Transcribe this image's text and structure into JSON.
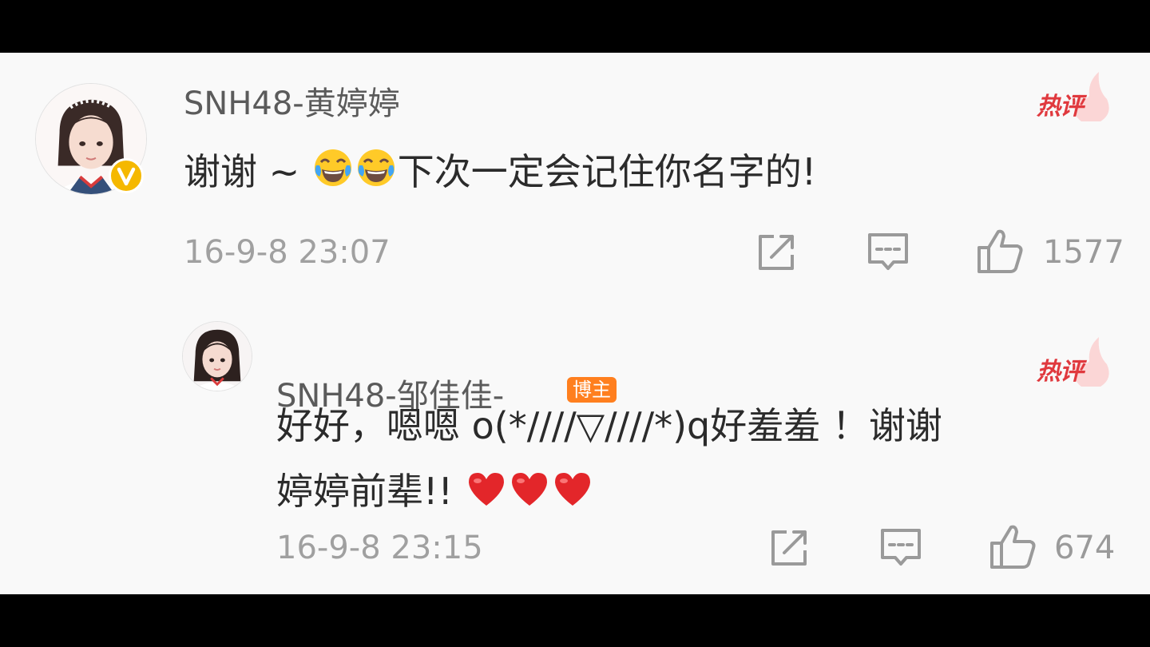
{
  "comments": [
    {
      "username": "SNH48-黄婷婷",
      "hot_label": "热评",
      "text_before": "谢谢 ~ ",
      "text_after": "下次一定会记住你名字的!",
      "emoji": [
        "laughing-tears-emoji",
        "laughing-tears-emoji"
      ],
      "timestamp": "16-9-8 23:07",
      "like_count": "1577",
      "verified": true
    },
    {
      "username": "SNH48-邹佳佳-",
      "author_badge": "博主",
      "hot_label": "热评",
      "text_line1": "好好，嗯嗯 o(*////▽////*)q好羞羞 ！谢谢",
      "text_line2": "婷婷前辈!! ",
      "emoji": [
        "red-heart-emoji",
        "red-heart-emoji",
        "red-heart-emoji"
      ],
      "timestamp": "16-9-8 23:15",
      "like_count": "674"
    }
  ],
  "colors": {
    "hot": "#e0393e",
    "badge": "#ff7f1e",
    "verified": "#f5b800",
    "text": "#2b2b2b",
    "meta": "#a0a0a0"
  }
}
